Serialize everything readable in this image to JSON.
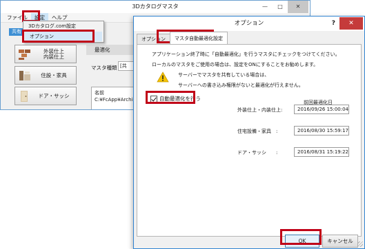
{
  "main_window": {
    "title": "3Dカタログマスタ",
    "controls": {
      "minimize": "—",
      "maximize": "□",
      "close": "✕"
    },
    "menu": [
      {
        "label": "ファイル"
      },
      {
        "label": "設定"
      },
      {
        "label": "ヘルプ"
      }
    ],
    "dropdown": [
      {
        "label": "3Dカタログ.com設定"
      },
      {
        "label": "オプション"
      }
    ],
    "left_tab": "共有",
    "categories": [
      {
        "label_line1": "外装仕上",
        "label_line2": "内装仕上",
        "icon": "brick-icon"
      },
      {
        "label_line1": "住設・家具",
        "label_line2": "",
        "icon": "bath-icon"
      },
      {
        "label_line1": "ドア・サッシ",
        "label_line2": "",
        "icon": "door-icon"
      }
    ],
    "right_panel": {
      "tab": "最適化",
      "master_type_label": "マスタ種類",
      "master_type_value": "[共",
      "list_header": "名前",
      "list_row": "C:¥FcApp¥Archi"
    }
  },
  "dialog": {
    "title": "オプション",
    "help": "?",
    "close": "✕",
    "tabs": [
      {
        "label": "オプション"
      },
      {
        "label": "マスタ自動最適化設定"
      }
    ],
    "desc_line1": "アプリケーション終了時に「自動最適化」を行うマスタにチェックをつけてください。",
    "desc_line2": "ローカルのマスタをご使用の場合は、設定をONにすることをお勧めします。",
    "warning_line1": "サーバーでマスタを共有している場合は、",
    "warning_line2": "サーバーへの書き込み権限がないと最適化が行えません。",
    "checkbox_label": "自動最適化を行う",
    "checkbox_checked": true,
    "column_header": "前回最適化日",
    "rows": [
      {
        "label": "外装仕上・内装仕上:",
        "date": "2016/09/26 15:00:04"
      },
      {
        "label": "住宅設備・家具　:",
        "date": "2016/08/30 15:59:17"
      },
      {
        "label": "ドア・サッシ　　:",
        "date": "2016/08/31 15:19:22"
      }
    ],
    "ok_label": "OK",
    "cancel_label": "キャンセル"
  },
  "colors": {
    "highlight_red": "#c00017",
    "accent_blue": "#2f83d1"
  }
}
